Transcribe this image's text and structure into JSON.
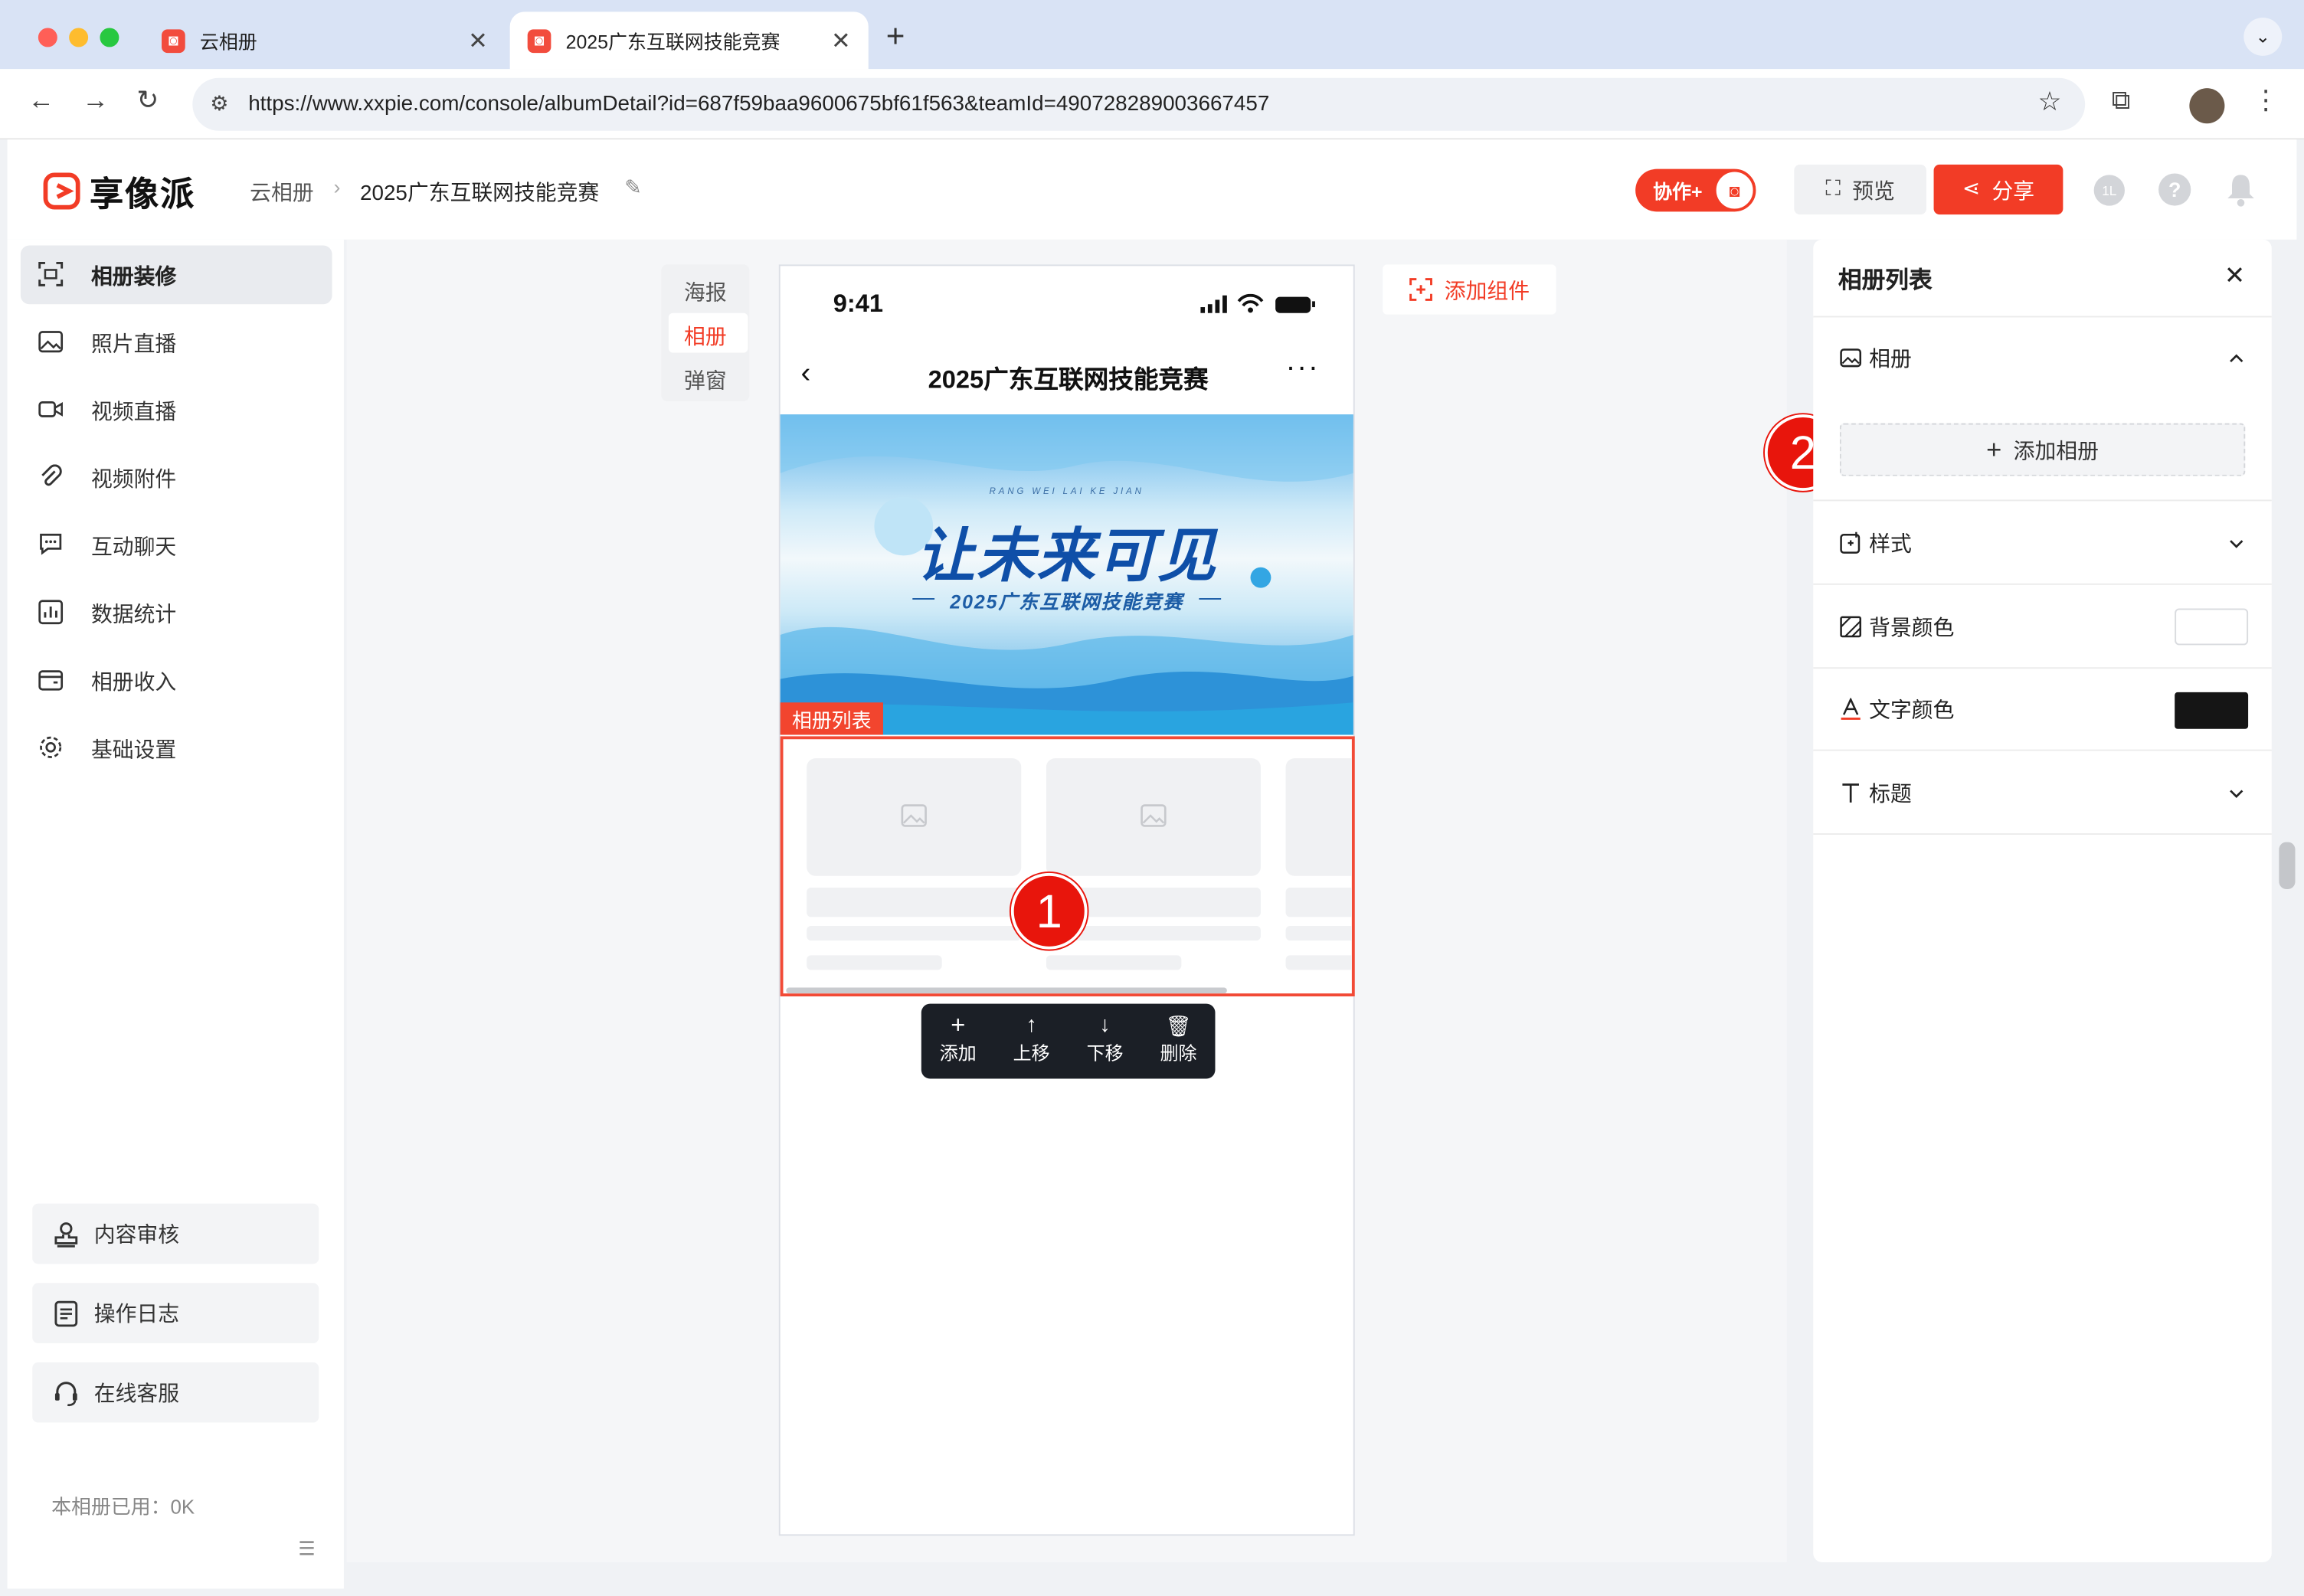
{
  "browser": {
    "tabs": [
      {
        "title": "云相册"
      },
      {
        "title": "2025广东互联网技能竞赛"
      }
    ],
    "url": "https://www.xxpie.com/console/albumDetail?id=687f59baa9600675bf61f563&teamId=490728289003667457"
  },
  "header": {
    "logo_text": "享像派",
    "breadcrumb_root": "云相册",
    "breadcrumb_current": "2025广东互联网技能竞赛",
    "collab": "协作+",
    "preview": "预览",
    "share": "分享"
  },
  "sidebar": {
    "items": [
      {
        "label": "相册装修"
      },
      {
        "label": "照片直播"
      },
      {
        "label": "视频直播"
      },
      {
        "label": "视频附件"
      },
      {
        "label": "互动聊天"
      },
      {
        "label": "数据统计"
      },
      {
        "label": "相册收入"
      },
      {
        "label": "基础设置"
      }
    ],
    "utilities": [
      {
        "label": "内容审核"
      },
      {
        "label": "操作日志"
      },
      {
        "label": "在线客服"
      }
    ],
    "usage": "本相册已用：0K"
  },
  "editor": {
    "segments": [
      "海报",
      "相册",
      "弹窗"
    ],
    "add_component": "添加组件"
  },
  "phone": {
    "time": "9:41",
    "title": "2025广东互联网技能竞赛",
    "banner_pinyin": "RANG WEI LAI KE JIAN",
    "banner_slogan": "让未来可见",
    "banner_subtitle": "2025广东互联网技能竞赛",
    "section_tag": "相册列表",
    "toolbar": [
      "添加",
      "上移",
      "下移",
      "删除"
    ]
  },
  "panel": {
    "title": "相册列表",
    "album_label": "相册",
    "add_album": "添加相册",
    "style_label": "样式",
    "bg_color_label": "背景颜色",
    "bg_color": "#ffffff",
    "text_color_label": "文字颜色",
    "text_color": "#151515",
    "title_label": "标题"
  },
  "badges": [
    "1",
    "2"
  ]
}
